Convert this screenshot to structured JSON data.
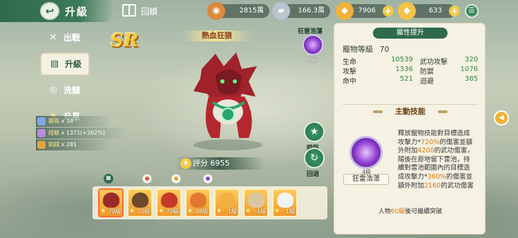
{
  "header": {
    "title": "升級",
    "back_glyph": "↩",
    "gift_label": "回饋",
    "resources": [
      {
        "icon": "copper-coin-icon",
        "glyph": "◉",
        "value": "2815萬"
      },
      {
        "icon": "silver-ingot-icon",
        "glyph": "▰",
        "value": "166.3萬"
      },
      {
        "icon": "gold-ingot-icon",
        "glyph": "◆",
        "value": "7906"
      },
      {
        "icon": "yuanbao-icon",
        "glyph": "◆",
        "value": "633"
      }
    ],
    "plus_glyph": "+",
    "menu_glyph": "☰"
  },
  "nav": {
    "items": [
      {
        "label": "出戰",
        "glyph": "✕"
      },
      {
        "label": "升級",
        "glyph": "▤"
      },
      {
        "label": "洗髓",
        "glyph": "◎"
      },
      {
        "label": "升星",
        "glyph": "★"
      }
    ]
  },
  "materials": [
    {
      "name": "銀兩",
      "value": "x 14",
      "color": "#7fa7e8"
    },
    {
      "name": "經驗",
      "value": "x 1371(+262%)",
      "color": "#b88ae0"
    },
    {
      "name": "銅錢",
      "value": "x 281",
      "color": "#e0a34a"
    }
  ],
  "pet": {
    "rarity": "SR",
    "name": "熱血狂狼",
    "score_label": "評分",
    "score_value": "6955",
    "score_glyph": "★"
  },
  "top_skill": {
    "name": "狂雷浩蕩",
    "level": "4級"
  },
  "actions": {
    "gift_label": "時裝",
    "gift_glyph": "★",
    "recycle_label": "回退",
    "recycle_glyph": "↻"
  },
  "tabs": [
    {
      "glyph": "▦"
    },
    {
      "glyph": "●"
    },
    {
      "glyph": "●"
    },
    {
      "glyph": "●"
    }
  ],
  "pets": [
    {
      "level": "70級",
      "color": "#9a2b2b",
      "star": "★"
    },
    {
      "level": "70級",
      "color": "#6b4a2a",
      "star": "★"
    },
    {
      "level": "70級",
      "color": "#c53a2a",
      "star": "★"
    },
    {
      "level": "48級",
      "color": "#e07830",
      "star": "★"
    },
    {
      "level": "1級",
      "color": "#f2b040",
      "star": "★"
    },
    {
      "level": "1級",
      "color": "#d8c8a0",
      "star": "★"
    },
    {
      "level": "1級",
      "color": "#f3f3f3",
      "star": "★"
    }
  ],
  "stats": {
    "title": "屬性提升",
    "level_label": "寵物等級",
    "level_value": "70",
    "rows": [
      {
        "k": "生命",
        "v": "10539",
        "k2": "武功攻擊",
        "v2": "320"
      },
      {
        "k": "攻擊",
        "v": "1336",
        "k2": "防禦",
        "v2": "1076"
      },
      {
        "k": "命中",
        "v": "521",
        "k2": "迴避",
        "v2": "385"
      }
    ]
  },
  "active_skill": {
    "title": "主動技能",
    "name": "狂雷浩蕩",
    "level": "4級",
    "desc_parts": [
      {
        "t": "釋放寵物技能對目標造成攻擊力*"
      },
      {
        "t": "720%",
        "hl": true
      },
      {
        "t": "的傷害並額外附加"
      },
      {
        "t": "4200",
        "hl": true
      },
      {
        "t": "的武功傷害，隨後在原地留下雷池，持續對雷池範圍內的目標造成攻擊力*"
      },
      {
        "t": "360%",
        "hl": true
      },
      {
        "t": "的傷害並額外附加"
      },
      {
        "t": "2160",
        "hl": true
      },
      {
        "t": "的武功傷害"
      }
    ]
  },
  "breakthrough": {
    "prefix": "人物",
    "level": "60級",
    "suffix": "後可繼續突破"
  },
  "side_toggle_glyph": "◀"
}
